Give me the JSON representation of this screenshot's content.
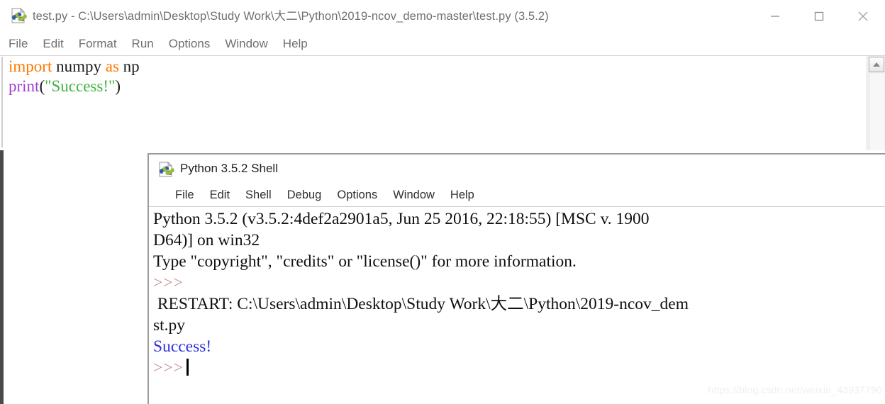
{
  "editor_window": {
    "icon": "python-idle-icon",
    "title": "test.py - C:\\Users\\admin\\Desktop\\Study Work\\大二\\Python\\2019-ncov_demo-master\\test.py (3.5.2)",
    "window_controls": [
      {
        "name": "minimize",
        "glyph": "minimize-icon"
      },
      {
        "name": "maximize",
        "glyph": "maximize-icon"
      },
      {
        "name": "close",
        "glyph": "close-icon"
      }
    ],
    "menu": [
      "File",
      "Edit",
      "Format",
      "Run",
      "Options",
      "Window",
      "Help"
    ],
    "code_lines": [
      [
        {
          "text": "import",
          "style": "kw"
        },
        {
          "text": " numpy ",
          "style": "plain"
        },
        {
          "text": "as",
          "style": "kw"
        },
        {
          "text": " np",
          "style": "plain"
        }
      ],
      [
        {
          "text": "print",
          "style": "builtin"
        },
        {
          "text": "(",
          "style": "plain"
        },
        {
          "text": "\"Success!\"",
          "style": "str"
        },
        {
          "text": ")",
          "style": "plain"
        }
      ]
    ],
    "scrollbar": {
      "up_arrow": "scroll-up-arrow-icon"
    }
  },
  "shell_window": {
    "icon": "python-idle-icon",
    "title": "Python 3.5.2 Shell",
    "menu": [
      "File",
      "Edit",
      "Shell",
      "Debug",
      "Options",
      "Window",
      "Help"
    ],
    "output_lines": [
      {
        "text": "Python 3.5.2 (v3.5.2:4def2a2901a5, Jun 25 2016, 22:18:55) [MSC v. 1900",
        "style": "normal"
      },
      {
        "text": "D64)] on win32",
        "style": "normal"
      },
      {
        "text": "Type \"copyright\", \"credits\" or \"license()\" for more information.",
        "style": "normal"
      },
      {
        "text": ">>>",
        "style": "prompt"
      },
      {
        "text": " RESTART: C:\\Users\\admin\\Desktop\\Study Work\\大二\\Python\\2019-ncov_dem",
        "style": "normal"
      },
      {
        "text": "st.py",
        "style": "normal"
      },
      {
        "text": "Success!",
        "style": "output"
      },
      {
        "text": ">>>",
        "style": "prompt",
        "caret": true
      }
    ]
  },
  "watermark": "https://blog.csdn.net/weixin_43937790",
  "colors": {
    "keyword": "#ff7700",
    "builtin": "#9f3fcf",
    "string": "#43b443",
    "prompt": "#c08a8a",
    "shell_output": "#2f2fdf",
    "title_text": "#6f6f6f"
  }
}
